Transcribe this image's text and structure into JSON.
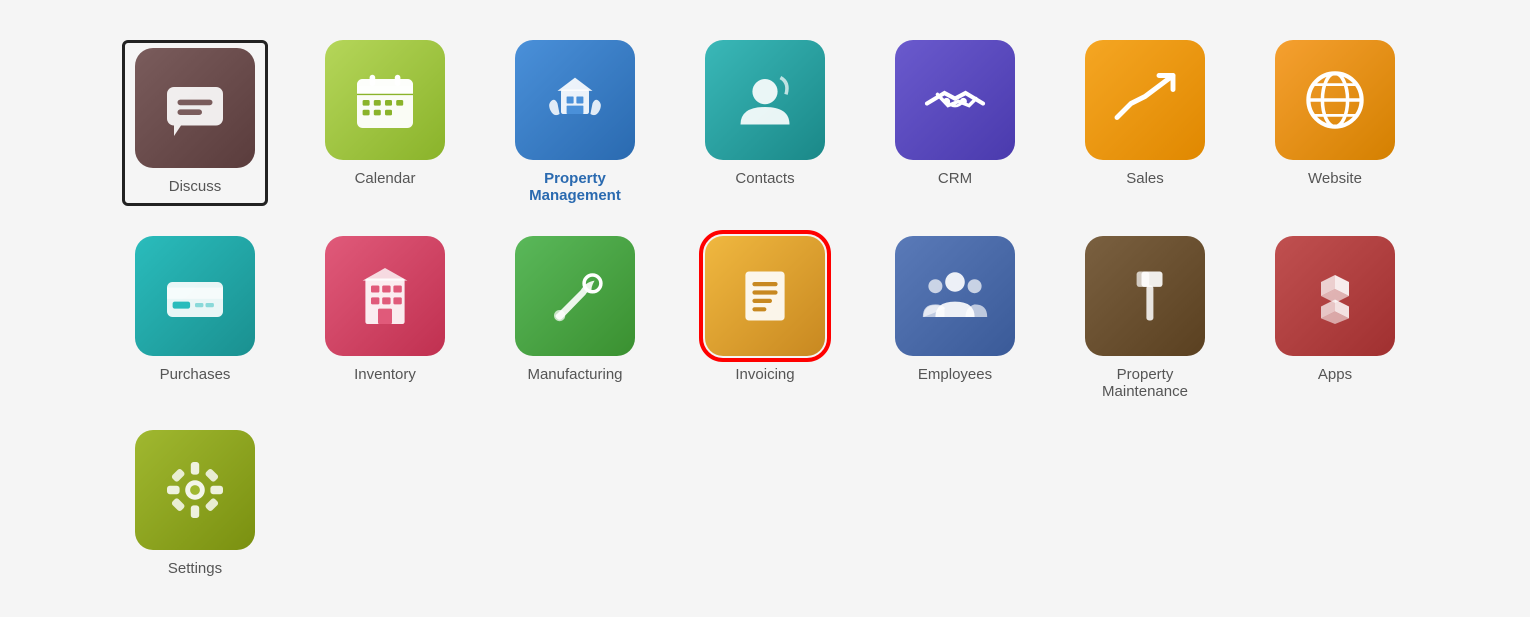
{
  "apps": [
    {
      "id": "discuss",
      "label": "Discuss",
      "bg": "bg-brown",
      "icon": "discuss",
      "selected_box": true,
      "selected": false,
      "row": 1
    },
    {
      "id": "calendar",
      "label": "Calendar",
      "bg": "bg-green-lime",
      "icon": "calendar",
      "selected_box": false,
      "selected": false,
      "row": 1
    },
    {
      "id": "property-management",
      "label": "Property Management",
      "bg": "bg-blue",
      "icon": "property-management",
      "selected_box": false,
      "selected": false,
      "row": 1
    },
    {
      "id": "contacts",
      "label": "Contacts",
      "bg": "bg-teal",
      "icon": "contacts",
      "selected_box": false,
      "selected": false,
      "row": 1
    },
    {
      "id": "crm",
      "label": "CRM",
      "bg": "bg-indigo",
      "icon": "crm",
      "selected_box": false,
      "selected": false,
      "row": 1
    },
    {
      "id": "sales",
      "label": "Sales",
      "bg": "bg-orange",
      "icon": "sales",
      "selected_box": false,
      "selected": false,
      "row": 1
    },
    {
      "id": "website",
      "label": "Website",
      "bg": "bg-orange2",
      "icon": "website",
      "selected_box": false,
      "selected": false,
      "row": 2
    },
    {
      "id": "purchases",
      "label": "Purchases",
      "bg": "bg-teal2",
      "icon": "purchases",
      "selected_box": false,
      "selected": false,
      "row": 2
    },
    {
      "id": "inventory",
      "label": "Inventory",
      "bg": "bg-red-pink",
      "icon": "inventory",
      "selected_box": false,
      "selected": false,
      "row": 2
    },
    {
      "id": "manufacturing",
      "label": "Manufacturing",
      "bg": "bg-green2",
      "icon": "manufacturing",
      "selected_box": false,
      "selected": false,
      "row": 2
    },
    {
      "id": "invoicing",
      "label": "Invoicing",
      "bg": "bg-yellow-orange",
      "icon": "invoicing",
      "selected_box": false,
      "selected": true,
      "row": 2
    },
    {
      "id": "employees",
      "label": "Employees",
      "bg": "bg-slate-blue",
      "icon": "employees",
      "selected_box": false,
      "selected": false,
      "row": 2
    },
    {
      "id": "property-maintenance",
      "label": "Property Maintenance",
      "bg": "bg-dark-brown",
      "icon": "property-maintenance",
      "selected_box": false,
      "selected": false,
      "row": 3
    },
    {
      "id": "apps",
      "label": "Apps",
      "bg": "bg-red-brown",
      "icon": "apps",
      "selected_box": false,
      "selected": false,
      "row": 3
    },
    {
      "id": "settings",
      "label": "Settings",
      "bg": "bg-olive",
      "icon": "settings",
      "selected_box": false,
      "selected": false,
      "row": 3
    }
  ]
}
